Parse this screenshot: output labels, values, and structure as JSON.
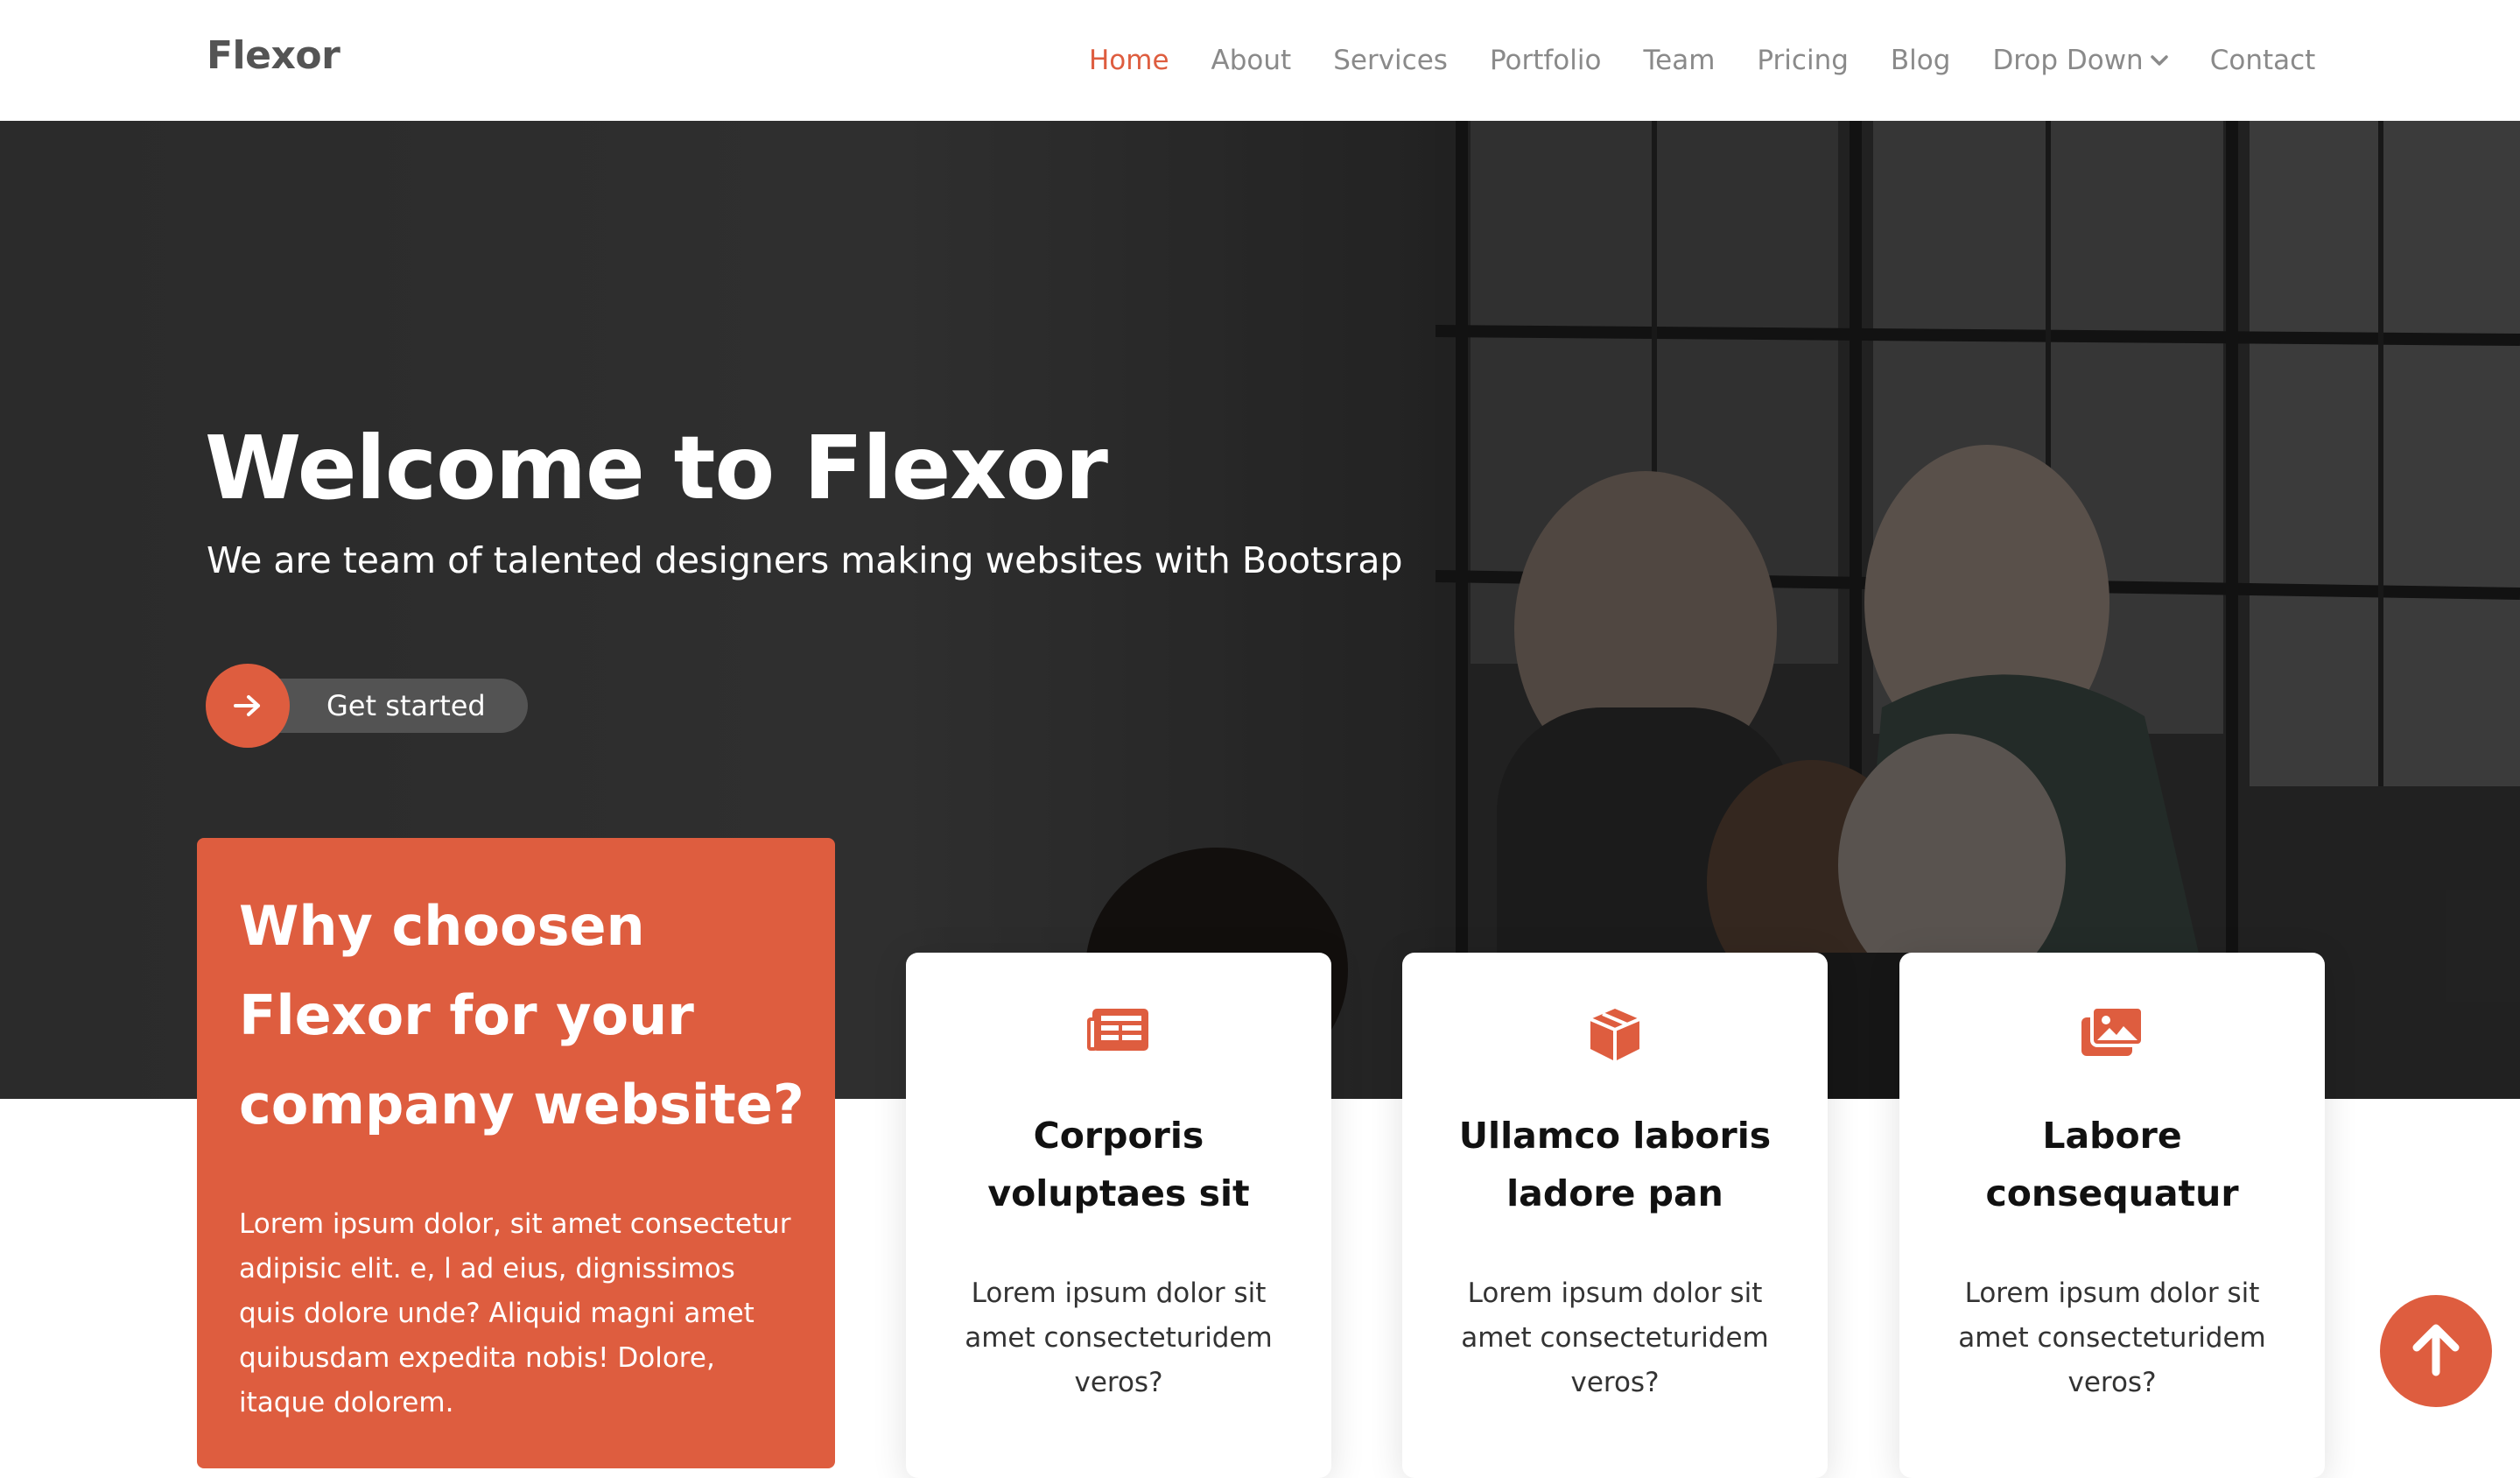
{
  "brand": {
    "logo": "Flexor",
    "accent_color": "#de5d3f"
  },
  "nav": {
    "items": [
      {
        "label": "Home",
        "active": true
      },
      {
        "label": "About"
      },
      {
        "label": "Services"
      },
      {
        "label": "Portfolio"
      },
      {
        "label": "Team"
      },
      {
        "label": "Pricing"
      },
      {
        "label": "Blog"
      },
      {
        "label": "Drop Down",
        "icon": "chevron-down-icon"
      },
      {
        "label": "Contact"
      }
    ]
  },
  "hero": {
    "title": "Welcome to Flexor",
    "subtitle": "We are team of talented designers making websites with Bootsrap",
    "cta": {
      "label": "Get started",
      "icon": "arrow-right-icon"
    }
  },
  "why": {
    "title": "Why choosen Flexor for your company website?",
    "text": "Lorem ipsum dolor, sit amet consectetur adipisic elit. e, l ad eius, dignissimos quis dolore unde? Aliquid magni amet quibusdam expedita nobis! Dolore, itaque dolorem."
  },
  "features": [
    {
      "icon": "newspaper-icon",
      "title": "Corporis voluptaes sit",
      "text": "Lorem ipsum dolor sit amet consecteturidem veros?"
    },
    {
      "icon": "box-icon",
      "title": "Ullamco laboris ladore pan",
      "text": "Lorem ipsum dolor sit amet consecteturidem veros?"
    },
    {
      "icon": "images-icon",
      "title": "Labore consequatur",
      "text": "Lorem ipsum dolor sit amet consecteturidem veros?"
    }
  ],
  "back_to_top": {
    "icon": "arrow-up-icon"
  }
}
